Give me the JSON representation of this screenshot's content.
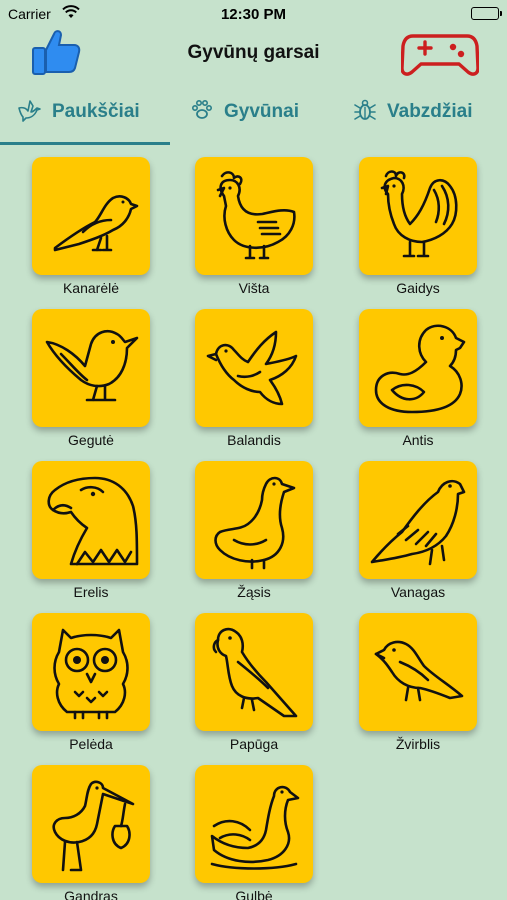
{
  "status": {
    "carrier": "Carrier",
    "time": "12:30 PM"
  },
  "nav": {
    "title": "Gyvūnų garsai",
    "left_icon": "thumbs-up-icon",
    "right_icon": "gamepad-icon"
  },
  "tabs": [
    {
      "label": "Paukščiai",
      "icon": "bird-icon",
      "selected": true
    },
    {
      "label": "Gyvūnai",
      "icon": "paw-icon",
      "selected": false
    },
    {
      "label": "Vabzdžiai",
      "icon": "bug-icon",
      "selected": false
    }
  ],
  "colors": {
    "background": "#c6e2cc",
    "tile": "#ffc800",
    "accent": "#2a7f8a",
    "thumb": "#2f8cf0",
    "gamepad": "#cc1f1f"
  },
  "animals": [
    {
      "name": "Kanarėlė",
      "icon": "canary-icon"
    },
    {
      "name": "Višta",
      "icon": "hen-icon"
    },
    {
      "name": "Gaidys",
      "icon": "rooster-icon"
    },
    {
      "name": "Gegutė",
      "icon": "cuckoo-icon"
    },
    {
      "name": "Balandis",
      "icon": "dove-icon"
    },
    {
      "name": "Antis",
      "icon": "duck-icon"
    },
    {
      "name": "Erelis",
      "icon": "eagle-icon"
    },
    {
      "name": "Žąsis",
      "icon": "goose-icon"
    },
    {
      "name": "Vanagas",
      "icon": "hawk-icon"
    },
    {
      "name": "Pelėda",
      "icon": "owl-icon"
    },
    {
      "name": "Papūga",
      "icon": "parrot-icon"
    },
    {
      "name": "Žvirblis",
      "icon": "sparrow-icon"
    },
    {
      "name": "Gandras",
      "icon": "stork-icon"
    },
    {
      "name": "Gulbė",
      "icon": "swan-icon"
    }
  ]
}
